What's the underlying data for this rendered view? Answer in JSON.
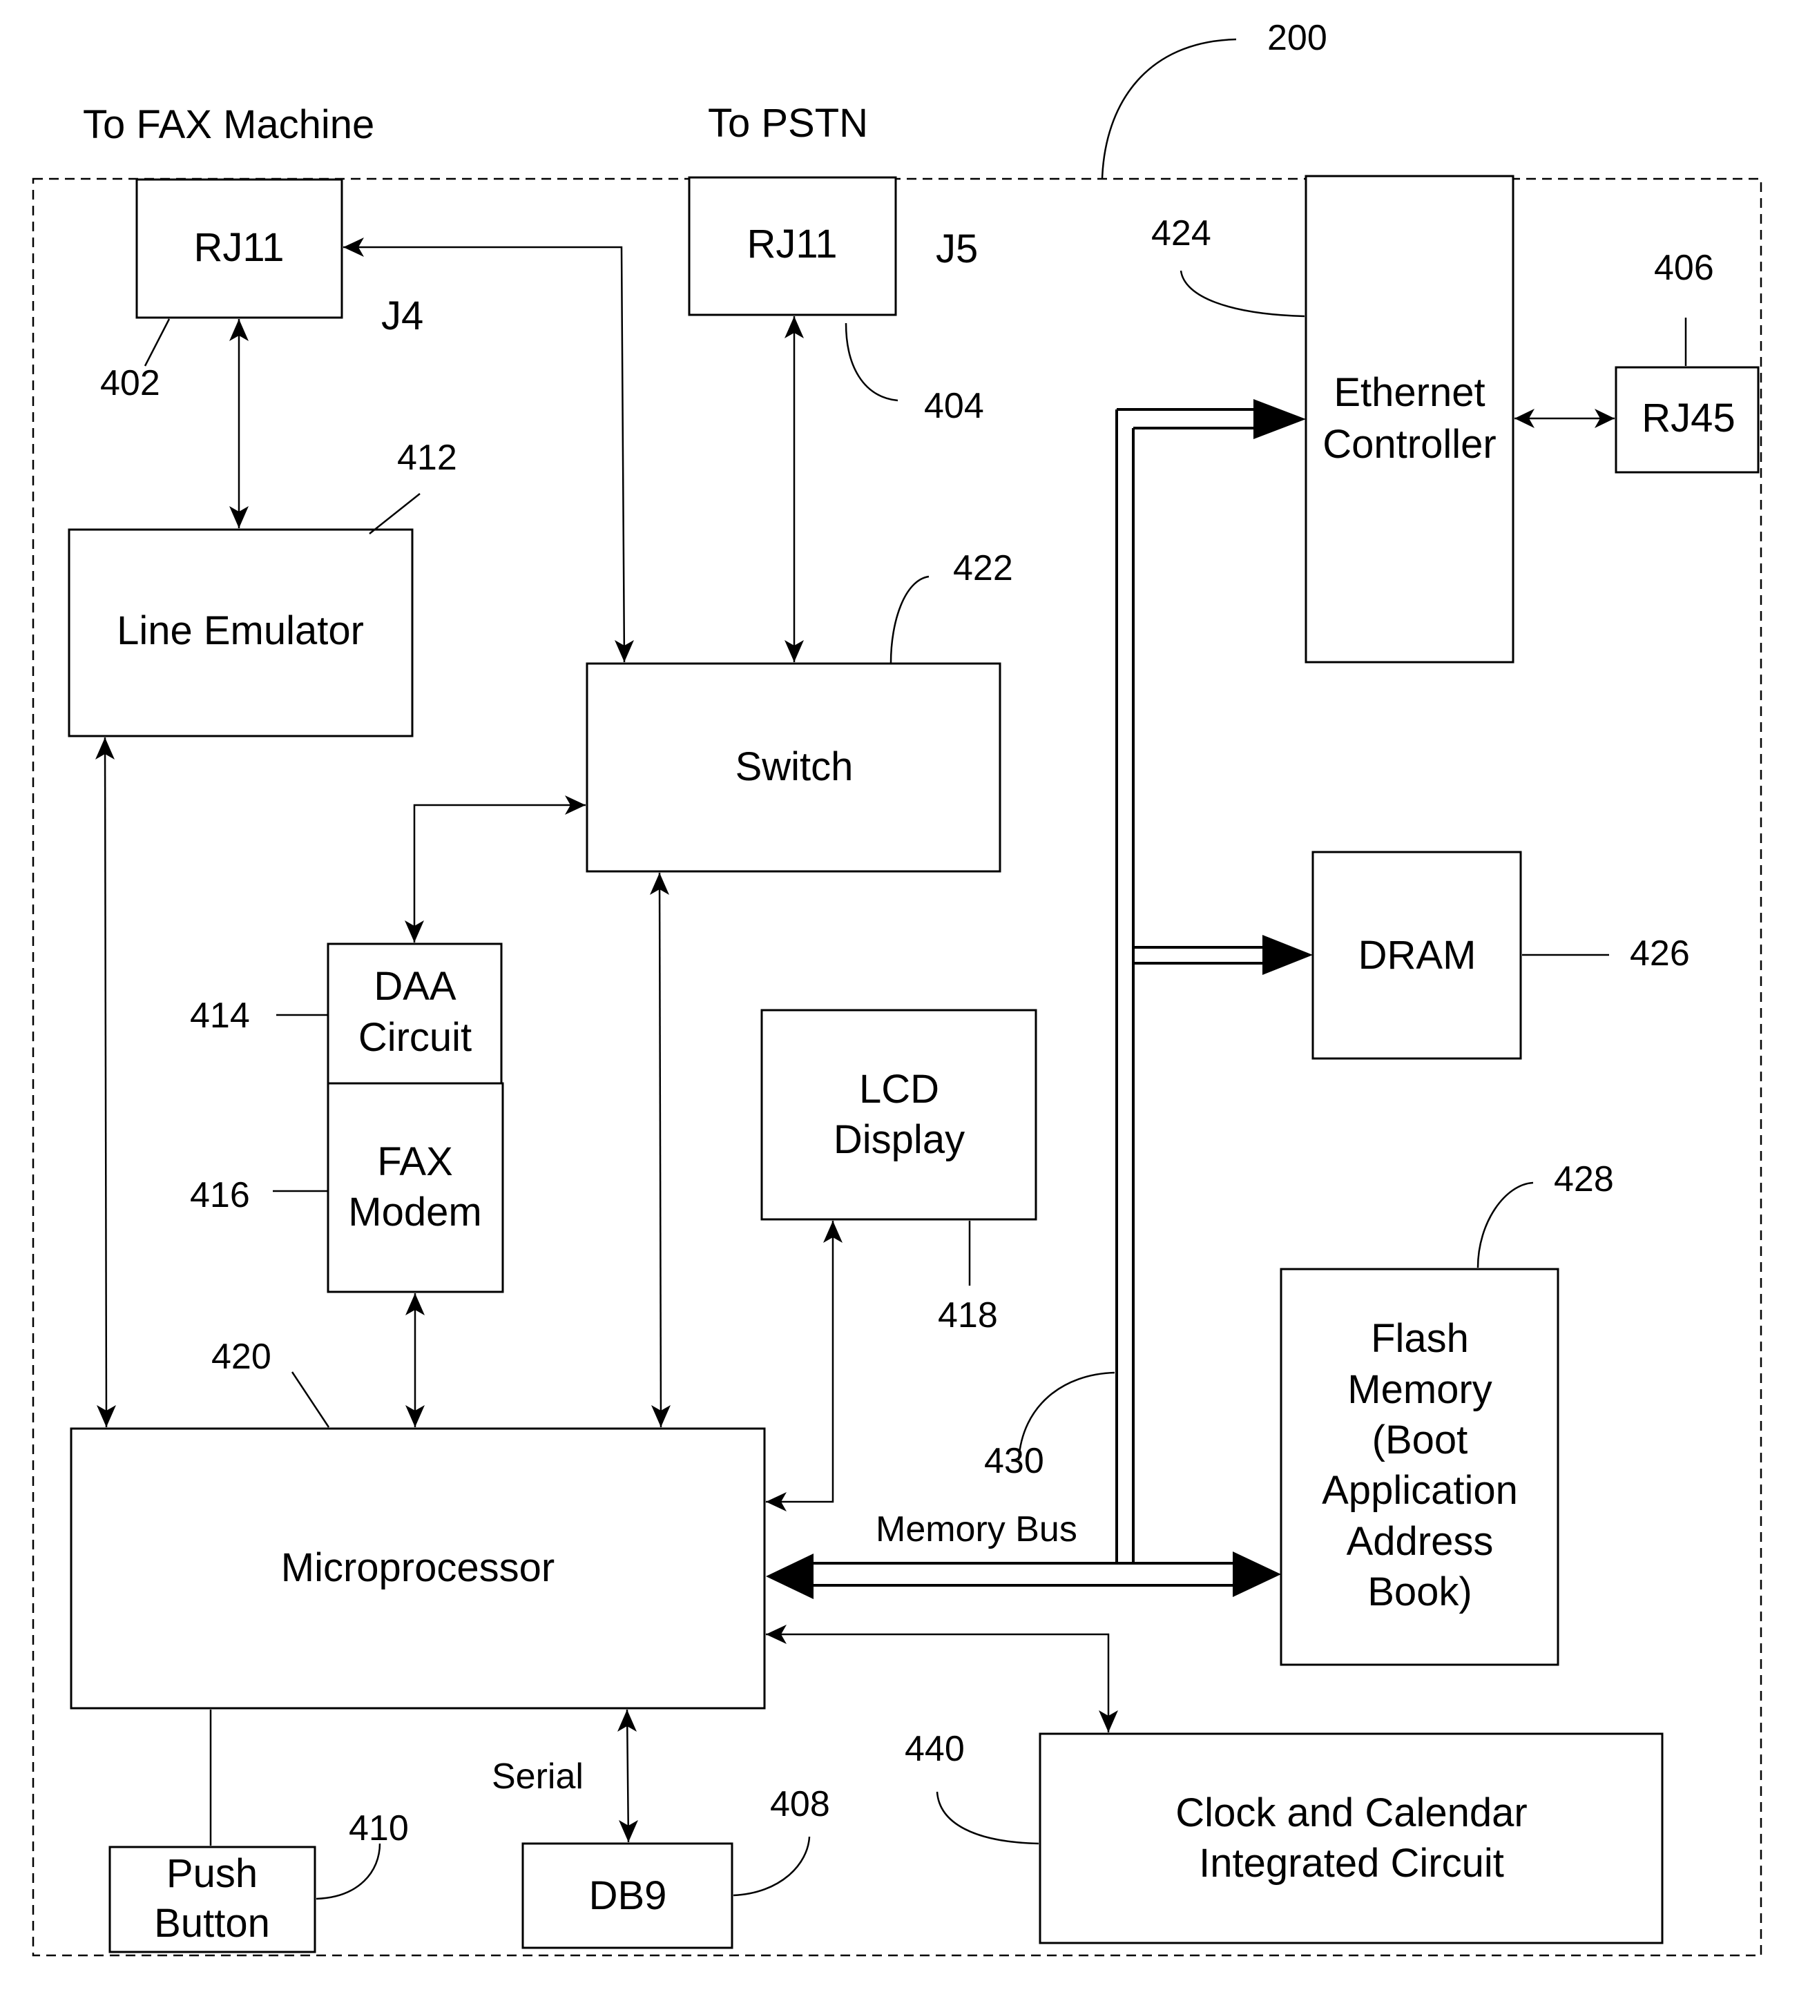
{
  "figure": {
    "reference": "200",
    "external_labels": {
      "fax_machine": "To FAX Machine",
      "pstn": "To PSTN"
    },
    "connector_labels": {
      "j4": "J4",
      "j5": "J5"
    },
    "blocks": {
      "rj11_fax": {
        "label": "RJ11",
        "ref": "402"
      },
      "rj11_pstn": {
        "label": "RJ11",
        "ref": "404"
      },
      "rj45": {
        "label": "RJ45",
        "ref": "406"
      },
      "db9": {
        "label": "DB9",
        "ref": "408"
      },
      "push_button": {
        "lines": [
          "Push",
          "Button"
        ],
        "ref": "410"
      },
      "line_emulator": {
        "label": "Line Emulator",
        "ref": "412"
      },
      "daa_circuit": {
        "lines": [
          "DAA",
          "Circuit"
        ],
        "ref": "414"
      },
      "fax_modem": {
        "lines": [
          "FAX",
          "Modem"
        ],
        "ref": "416"
      },
      "lcd_display": {
        "lines": [
          "LCD",
          "Display"
        ],
        "ref": "418"
      },
      "microprocessor": {
        "label": "Microprocessor",
        "ref": "420"
      },
      "switch": {
        "label": "Switch",
        "ref": "422"
      },
      "ethernet_controller": {
        "lines": [
          "Ethernet",
          "Controller"
        ],
        "ref": "424"
      },
      "dram": {
        "label": "DRAM",
        "ref": "426"
      },
      "flash_memory": {
        "lines": [
          "Flash",
          "Memory",
          "(Boot",
          "Application",
          "Address",
          "Book)"
        ],
        "ref": "428"
      },
      "clock_calendar": {
        "lines": [
          "Clock and Calendar",
          "Integrated Circuit"
        ],
        "ref": "440"
      }
    },
    "bus": {
      "label": "Memory Bus",
      "ref": "430"
    },
    "link_labels": {
      "serial": "Serial"
    }
  }
}
